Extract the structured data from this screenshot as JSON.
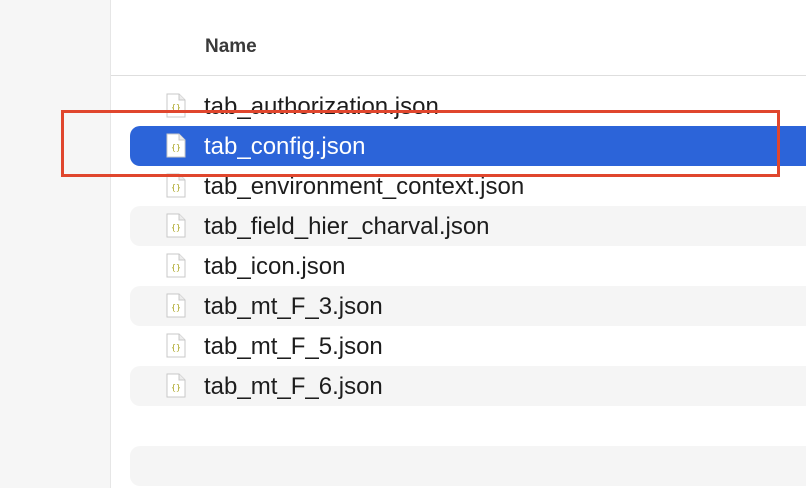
{
  "header": {
    "name_label": "Name"
  },
  "files": [
    {
      "name": "tab_authorization.json",
      "icon": "json-file-icon",
      "selected": false
    },
    {
      "name": "tab_config.json",
      "icon": "json-file-icon",
      "selected": true
    },
    {
      "name": "tab_environment_context.json",
      "icon": "json-file-icon",
      "selected": false
    },
    {
      "name": "tab_field_hier_charval.json",
      "icon": "json-file-icon",
      "selected": false
    },
    {
      "name": "tab_icon.json",
      "icon": "json-file-icon",
      "selected": false
    },
    {
      "name": "tab_mt_F_3.json",
      "icon": "json-file-icon",
      "selected": false
    },
    {
      "name": "tab_mt_F_5.json",
      "icon": "json-file-icon",
      "selected": false
    },
    {
      "name": "tab_mt_F_6.json",
      "icon": "json-file-icon",
      "selected": false
    }
  ],
  "colors": {
    "selection": "#2c64d9",
    "highlight_box": "#e0462d",
    "alt_row": "#f5f5f5"
  },
  "file_icon_glyph": "{}"
}
